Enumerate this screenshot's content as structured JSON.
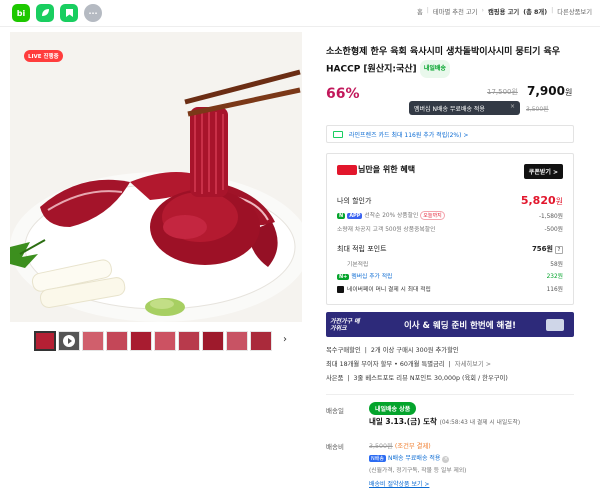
{
  "topbar": {
    "icons": [
      "bi",
      "leaf-icon",
      "bookmark-icon",
      "more-icon"
    ],
    "bi_label": "bi",
    "more_label": "···",
    "breadcrumbs": [
      "홈",
      "테마별 추천 고기",
      "캠핑용 고기",
      "(총 8개)",
      "다른상품보기"
    ]
  },
  "image": {
    "live_badge": "LIVE 진행중"
  },
  "product": {
    "title": "소소한형제 한우 육회 육사시미 생차돌박이사시미 뭉티기 육우 HACCP [원산지:국산]",
    "today_badge": "내일배송",
    "discount": "66%",
    "old_price": "17,500원",
    "price": "7,900",
    "price_unit": "원",
    "tooltip": "멤버십 N배송 무료배송 적용",
    "tooltip_close": "×",
    "ship_fee": "3,500원",
    "card_promo": "라인프렌즈 카드 최대 116원 추가 적립(2%) >"
  },
  "benefit": {
    "heading": "님만을 위한 혜택",
    "coupon_button": "쿠폰받기 >",
    "my_discount_label": "나의 할인가",
    "my_discount_amount": "5,820",
    "my_discount_unit": "원",
    "app_discount_label": "선착순 20% 상품할인",
    "app_discount_pill": "오늘까지",
    "app_discount_amount": "-1,580원",
    "cart_discount_label": "소량재 차공지 고객 500원 상품중복할인",
    "cart_discount_amount": "-500원",
    "points_label": "최대 적립 포인트",
    "points_amount": "756원",
    "basic_label": "기본적립",
    "basic_amount": "58원",
    "membership_label": "멤버십 추가 적립",
    "membership_amount": "232원",
    "npay_label": "네이버페이 머니 결제 시 최대 적립",
    "npay_amount": "116원"
  },
  "banner": {
    "left": "가전가구 메가위크",
    "text": "이사 & 웨딩 준비 한번에 해결!"
  },
  "info": {
    "multi_label": "복수구매할인",
    "multi_text": "2개 이상 구매시 300원 추가할인",
    "card_label": "최대 18개월 무이자 할부 • 60개월 특별금리",
    "card_more": "자세히보기 >",
    "review_label": "사은품",
    "review_text": "3줄 베스트포토 리뷰 N포인트 30,000p (육회 / 한우구이)"
  },
  "delivery": {
    "label": "배송일",
    "tag": "내일배송 상품",
    "arrive": "내일 3.13.(금) 도착",
    "arrive_note": "(04:58:43 내 결제 시 내일도착)",
    "fee_label": "배송비",
    "fee_old": "3,500원",
    "fee_cond": "(조건부 결제)",
    "nfree_tag": "N배송",
    "nfree_text": "N배송 무료배송 적용",
    "nfree_note": "(신월가격, 정기구독, 작물 등 일부 제외)",
    "nlink": "배송비 절약상품 보기 >"
  }
}
